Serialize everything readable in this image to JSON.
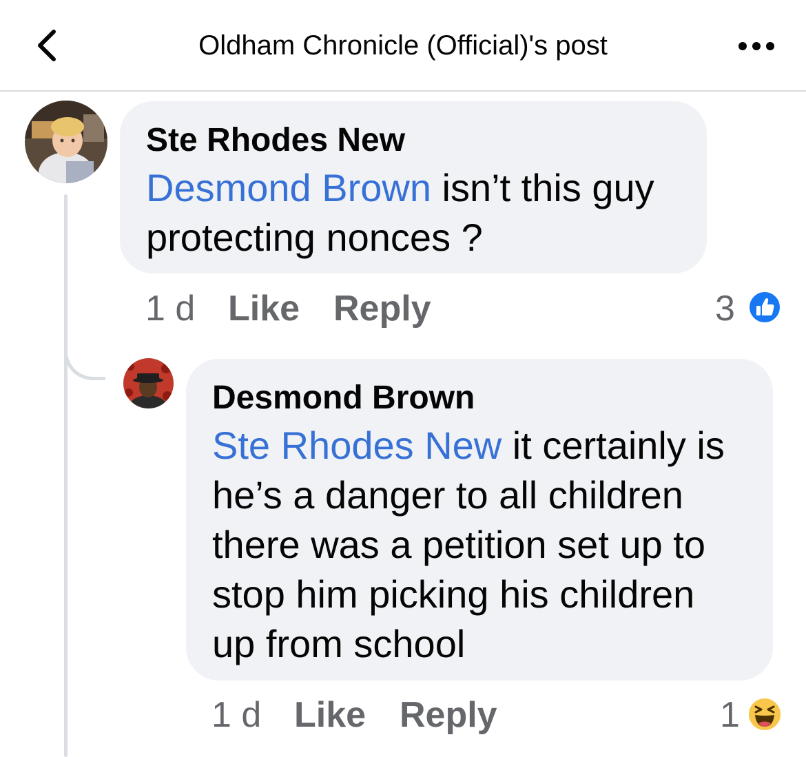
{
  "header": {
    "title": "Oldham Chronicle (Official)'s post",
    "back_icon": "chevron-left-icon",
    "more_icon": "more-horizontal-icon"
  },
  "comments": [
    {
      "author": "Ste Rhodes New",
      "mention": "Desmond Brown",
      "text": " isn’t this guy protecting nonces ?",
      "time": "1 d",
      "like_label": "Like",
      "reply_label": "Reply",
      "reaction_count": "3",
      "reaction_icon": "like-reaction-icon"
    },
    {
      "author": "Desmond Brown",
      "mention": "Ste Rhodes New",
      "text": " it certainly is he’s a danger to all children there was a petition set up to stop him picking his children up from school",
      "time": "1 d",
      "like_label": "Like",
      "reply_label": "Reply",
      "reaction_count": "1",
      "reaction_icon": "haha-reaction-icon"
    }
  ],
  "colors": {
    "mention": "#3771d6",
    "bubble": "#f0f2f5",
    "meta": "#65676b",
    "like_blue": "#1877f2"
  }
}
